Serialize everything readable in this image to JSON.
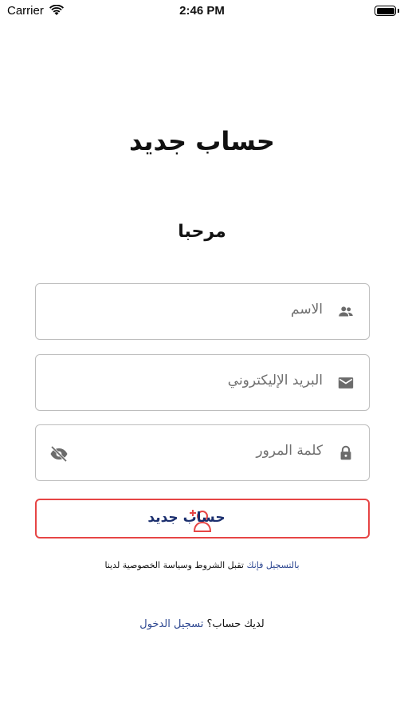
{
  "status_bar": {
    "carrier": "Carrier",
    "time": "2:46 PM"
  },
  "page": {
    "title": "حساب جديد",
    "welcome": "مرحبا"
  },
  "form": {
    "name_placeholder": "الاسم",
    "email_placeholder": "البريد الإليكتروني",
    "password_placeholder": "كلمة المرور",
    "name_icon": "people-icon",
    "email_icon": "mail-icon",
    "password_icon": "lock-icon",
    "toggle_icon": "eye-off-icon"
  },
  "register_button": {
    "label": "حساب جديد",
    "icon": "add-user-icon",
    "border_color": "#e64545",
    "text_color": "#1b2f6e"
  },
  "terms": {
    "prefix_link": "بالتسجيل فإنك",
    "text": "تقبل الشروط وسياسة الخصوصية لدينا"
  },
  "login_prompt": {
    "question": "لديك حساب؟",
    "link": "تسجيل الدخول"
  },
  "colors": {
    "link": "#2c4690",
    "field_border": "#bdbdbd"
  }
}
